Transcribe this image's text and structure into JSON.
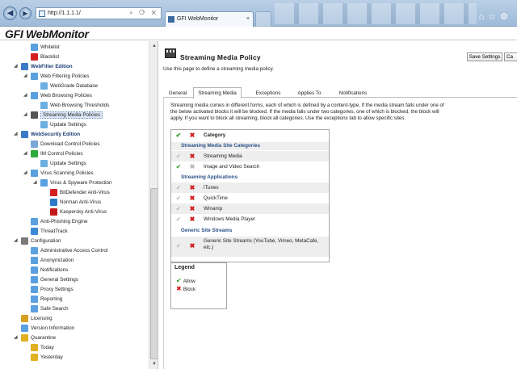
{
  "browser": {
    "address": "http://1.1.1.1/",
    "tab_title": "GFI WebMonitor",
    "tab_close": "×",
    "window_icons": [
      "home-icon",
      "star-icon",
      "gear-icon"
    ]
  },
  "app": {
    "logo": "GFI WebMonitor"
  },
  "sidebar": {
    "items": [
      {
        "label": "Whitelist",
        "icon": "check-doc-icon",
        "color": "#5aa0e0"
      },
      {
        "label": "Blacklist",
        "icon": "x-doc-icon",
        "color": "#d52020"
      },
      {
        "label": "WebFilter Edition",
        "icon": "globe-icon",
        "color": "#3a7ac8"
      },
      {
        "label": "Web Filtering Policies",
        "icon": "policy-icon",
        "color": "#5aa0e0"
      },
      {
        "label": "WebGrade Database",
        "icon": "database-icon",
        "color": "#6bb0e0"
      },
      {
        "label": "Web Browsing Policies",
        "icon": "policy-icon",
        "color": "#5aa0e0"
      },
      {
        "label": "Web Browsing Thresholds",
        "icon": "threshold-icon",
        "color": "#6bb0e0"
      },
      {
        "label": "Streaming Media Policies",
        "icon": "film-icon",
        "color": "#555555"
      },
      {
        "label": "Update Settings",
        "icon": "update-icon",
        "color": "#6bb0e0"
      },
      {
        "label": "WebSecurity Edition",
        "icon": "globe-icon",
        "color": "#3a7ac8"
      },
      {
        "label": "Download Control Policies",
        "icon": "download-icon",
        "color": "#7aa7d6"
      },
      {
        "label": "IM Control Policies",
        "icon": "im-icon",
        "color": "#2eaa3a"
      },
      {
        "label": "Update Settings",
        "icon": "update-icon",
        "color": "#6bb0e0"
      },
      {
        "label": "Virus Scanning Policies",
        "icon": "shield-icon",
        "color": "#5aa0e0"
      },
      {
        "label": "Virus & Spyware Protection",
        "icon": "protection-icon",
        "color": "#5aa0e0"
      },
      {
        "label": "BitDefender Anti-Virus",
        "icon": "bitdefender-icon",
        "color": "#d52020"
      },
      {
        "label": "Norman Anti-Virus",
        "icon": "norman-icon",
        "color": "#2a7ac8"
      },
      {
        "label": "Kaspersky Anti-Virus",
        "icon": "kaspersky-icon",
        "color": "#c21818"
      },
      {
        "label": "Anti-Phishing Engine",
        "icon": "phishing-icon",
        "color": "#5aa0e0"
      },
      {
        "label": "ThreatTrack",
        "icon": "threattrack-icon",
        "color": "#3a8ad8"
      },
      {
        "label": "Configuration",
        "icon": "config-icon",
        "color": "#7a7a7a"
      },
      {
        "label": "Administrative Access Control",
        "icon": "admin-icon",
        "color": "#5aa0e0"
      },
      {
        "label": "Anonymization",
        "icon": "anonymization-icon",
        "color": "#5aa0e0"
      },
      {
        "label": "Notifications",
        "icon": "notification-icon",
        "color": "#5aa0e0"
      },
      {
        "label": "General Settings",
        "icon": "settings-icon",
        "color": "#5aa0e0"
      },
      {
        "label": "Proxy Settings",
        "icon": "proxy-icon",
        "color": "#5aa0e0"
      },
      {
        "label": "Reporting",
        "icon": "reporting-icon",
        "color": "#5aa0e0"
      },
      {
        "label": "Safe Search",
        "icon": "search-icon",
        "color": "#5aa0e0"
      },
      {
        "label": "Licensing",
        "icon": "key-icon",
        "color": "#d8a020"
      },
      {
        "label": "Version Information",
        "icon": "info-icon",
        "color": "#5aa0e0"
      },
      {
        "label": "Quarantine",
        "icon": "quarantine-icon",
        "color": "#e0b020"
      },
      {
        "label": "Today",
        "icon": "folder-icon",
        "color": "#e0b020"
      },
      {
        "label": "Yesterday",
        "icon": "folder-icon",
        "color": "#e0b020"
      }
    ]
  },
  "page": {
    "title": "Streaming Media Policy",
    "description": "Use this page to define a streaming media policy.",
    "save_label": "Save Settings",
    "cancel_label": "Ca"
  },
  "tabs": [
    "General",
    "Streaming Media",
    "Exceptions",
    "Applies To",
    "Notifications"
  ],
  "content": {
    "intro": "Streaming media comes in different forms, each of which is defined by a content-type. If the media stream falls under one of the below activated blocks it will be blocked. If the media falls under two categories, one of which is blocked, the block will apply. If you want to block all streaming, block all categories. Use the exceptions tab to allow specific sites.",
    "header_label": "Category",
    "sections": [
      "Streaming Media Site Categories",
      "Streaming Applications",
      "Generic Site Streams"
    ],
    "rows": [
      {
        "label": "Streaming Media",
        "allow": false,
        "block": true
      },
      {
        "label": "Image and Video Search",
        "allow": true,
        "block": false
      },
      {
        "label": "iTunes",
        "allow": false,
        "block": true
      },
      {
        "label": "QuickTime",
        "allow": false,
        "block": true
      },
      {
        "label": "Winamp",
        "allow": false,
        "block": true
      },
      {
        "label": "Windows Media Player",
        "allow": false,
        "block": true
      },
      {
        "label": "Generic Site Streams (YouTube, Vimeo, MetaCafe, etc.)",
        "allow": false,
        "block": true
      }
    ]
  },
  "legend": {
    "title": "Legend",
    "allow": "Allow",
    "block": "Block"
  },
  "colors": {
    "allow_green": "#2b9a23",
    "block_red": "#d21b1b",
    "accent_blue": "#2a5088"
  }
}
